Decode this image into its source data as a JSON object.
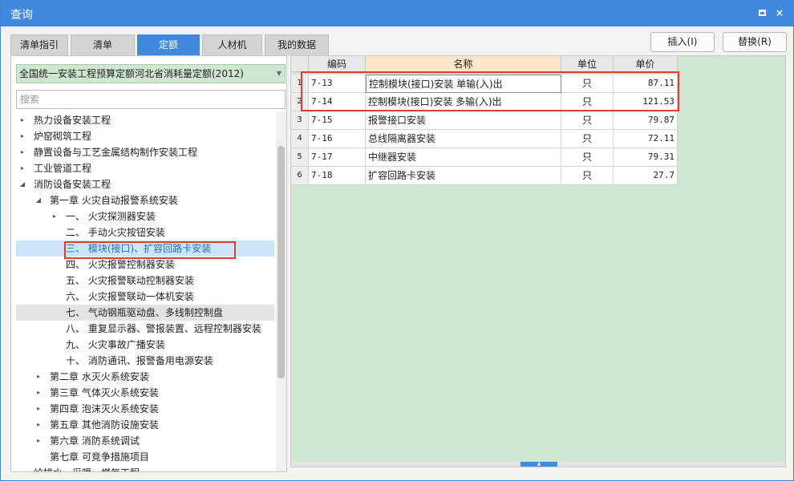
{
  "window": {
    "title": "查询",
    "restore_label": "",
    "close_label": "×"
  },
  "tabs": [
    {
      "label": "清单指引"
    },
    {
      "label": "清单"
    },
    {
      "label": "定额",
      "active": true
    },
    {
      "label": "人材机"
    },
    {
      "label": "我的数据"
    }
  ],
  "actions": {
    "insert_label": "插入(I)",
    "replace_label": "替换(R)"
  },
  "left_panel": {
    "quota_library": "全国统一安装工程预算定额河北省消耗量定额(2012)",
    "search_placeholder": "搜索",
    "tree": [
      {
        "label": "热力设备安装工程",
        "expander": "▸",
        "level": 0
      },
      {
        "label": "炉窑砌筑工程",
        "expander": "▸",
        "level": 0
      },
      {
        "label": "静置设备与工艺金属结构制作安装工程",
        "expander": "▸",
        "level": 0
      },
      {
        "label": "工业管道工程",
        "expander": "▸",
        "level": 0
      },
      {
        "label": "消防设备安装工程",
        "expander": "◢",
        "level": 0
      },
      {
        "label": "第一章  火灾自动报警系统安装",
        "expander": "◢",
        "level": 1
      },
      {
        "label": "一、  火灾探测器安装",
        "expander": "▸",
        "level": 2
      },
      {
        "label": "二、  手动火灾按钮安装",
        "expander": "",
        "level": 2
      },
      {
        "label": "三、  模块(接口)、扩容回路卡安装",
        "expander": "",
        "level": 2,
        "selected": true
      },
      {
        "label": "四、  火灾报警控制器安装",
        "expander": "",
        "level": 2
      },
      {
        "label": "五、  火灾报警联动控制器安装",
        "expander": "",
        "level": 2
      },
      {
        "label": "六、  火灾报警联动一体机安装",
        "expander": "",
        "level": 2
      },
      {
        "label": "七、  气动钢瓶驱动盘、多线制控制盘",
        "expander": "",
        "level": 2,
        "hover": true
      },
      {
        "label": "八、  重复显示器、警报装置、远程控制器安装",
        "expander": "",
        "level": 2
      },
      {
        "label": "九、  火灾事故广播安装",
        "expander": "",
        "level": 2
      },
      {
        "label": "十、  消防通讯、报警备用电源安装",
        "expander": "",
        "level": 2
      },
      {
        "label": "第二章  水灭火系统安装",
        "expander": "▸",
        "level": 1
      },
      {
        "label": "第三章  气体灭火系统安装",
        "expander": "▸",
        "level": 1
      },
      {
        "label": "第四章  泡沫灭火系统安装",
        "expander": "▸",
        "level": 1
      },
      {
        "label": "第五章  其他消防设施安装",
        "expander": "▸",
        "level": 1
      },
      {
        "label": "第六章  消防系统调试",
        "expander": "▸",
        "level": 1
      },
      {
        "label": "第七章  可竞争措施项目",
        "expander": "",
        "level": 1
      },
      {
        "label": "给排水、采暖、燃气工程",
        "expander": "▸",
        "level": 0
      }
    ]
  },
  "grid": {
    "headers": {
      "index": "",
      "code": "编码",
      "name": "名称",
      "unit": "单位",
      "price": "单价"
    },
    "rows": [
      {
        "index": "1",
        "code": "7-13",
        "name": "控制模块(接口)安装 单输(入)出",
        "unit": "只",
        "price": "87.11"
      },
      {
        "index": "2",
        "code": "7-14",
        "name": "控制模块(接口)安装 多输(入)出",
        "unit": "只",
        "price": "121.53"
      },
      {
        "index": "3",
        "code": "7-15",
        "name": "报警接口安装",
        "unit": "只",
        "price": "79.87"
      },
      {
        "index": "4",
        "code": "7-16",
        "name": "总线隔离器安装",
        "unit": "只",
        "price": "72.11"
      },
      {
        "index": "5",
        "code": "7-17",
        "name": "中继器安装",
        "unit": "只",
        "price": "79.31"
      },
      {
        "index": "6",
        "code": "7-18",
        "name": "扩容回路卡安装",
        "unit": "只",
        "price": "27.7"
      }
    ]
  },
  "colors": {
    "accent": "#3f8ae0",
    "grid_background": "#cfe7d0",
    "highlight_outline": "#e53935"
  }
}
